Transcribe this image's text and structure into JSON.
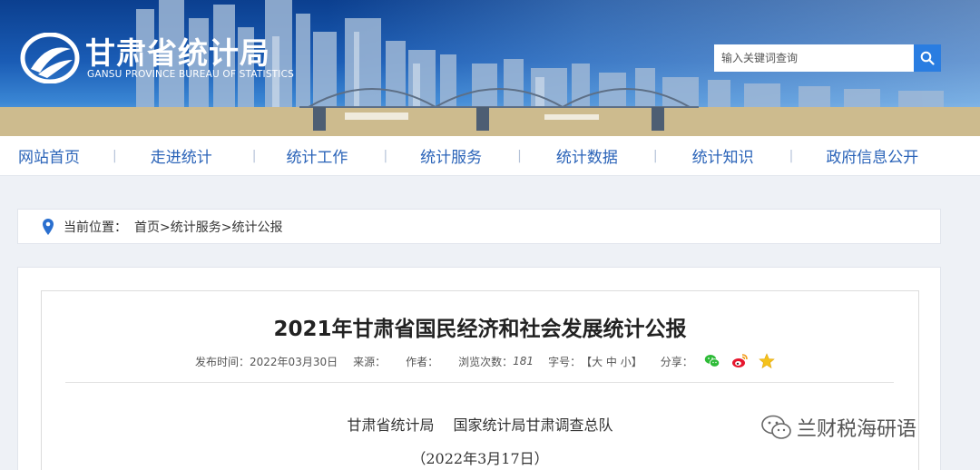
{
  "header": {
    "logo_title": "甘肃省统计局",
    "logo_subtitle": "GANSU PROVINCE BUREAU OF STATISTICS",
    "search_placeholder": "输入关键词查询",
    "search_icon": "search-icon"
  },
  "nav": {
    "items": [
      "网站首页",
      "走进统计",
      "统计工作",
      "统计服务",
      "统计数据",
      "统计知识",
      "政府信息公开"
    ]
  },
  "breadcrumb": {
    "label": "当前位置：",
    "path": "首页>统计服务>统计公报"
  },
  "article": {
    "title": "2021年甘肃省国民经济和社会发展统计公报",
    "publish_label": "发布时间：",
    "publish_date": "2022年03月30日",
    "source_label": "来源：",
    "author_label": "作者：",
    "views_label": "浏览次数：",
    "views_count": "181",
    "font_label": "字号：",
    "font_sizes": "【大 中 小】",
    "share_label": "分享：",
    "share_icons": [
      "wechat-icon",
      "weibo-icon",
      "favorite-icon"
    ],
    "authors": "甘肃省统计局　 国家统计局甘肃调查总队",
    "date": "（2022年3月17日）"
  },
  "watermark": {
    "text": "兰财税海研语"
  },
  "colors": {
    "nav_text": "#2a63b8",
    "search_button": "#2a7de1",
    "banner_top": "#0b3f8f"
  }
}
